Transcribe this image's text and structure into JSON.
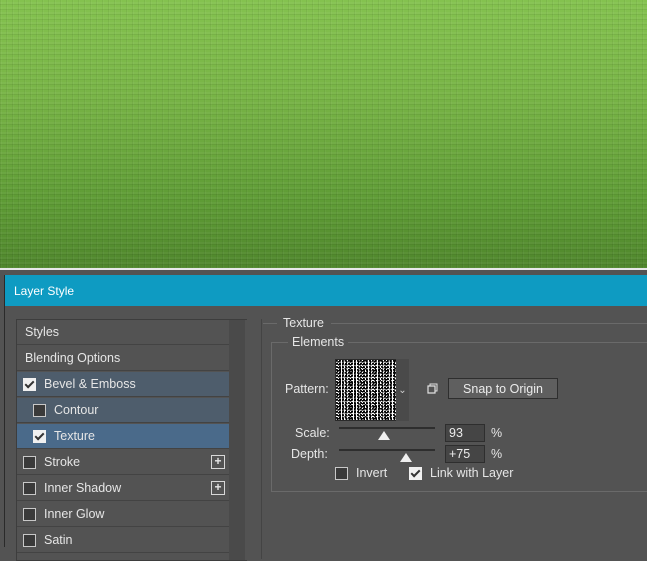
{
  "dialog": {
    "title": "Layer Style"
  },
  "styles_panel": {
    "items": [
      {
        "label": "Styles"
      },
      {
        "label": "Blending Options"
      },
      {
        "label": "Bevel & Emboss",
        "checked": true
      },
      {
        "label": "Contour",
        "checked": false
      },
      {
        "label": "Texture",
        "checked": true,
        "selected": true
      },
      {
        "label": "Stroke",
        "checked": false,
        "add": "+"
      },
      {
        "label": "Inner Shadow",
        "checked": false,
        "add": "+"
      },
      {
        "label": "Inner Glow",
        "checked": false
      },
      {
        "label": "Satin",
        "checked": false
      }
    ]
  },
  "texture": {
    "section_title": "Texture",
    "group_title": "Elements",
    "pattern_label": "Pattern:",
    "snap_button": "Snap to Origin",
    "scale_label": "Scale:",
    "scale_value": "93",
    "scale_unit": "%",
    "depth_label": "Depth:",
    "depth_value": "+75",
    "depth_unit": "%",
    "invert_label": "Invert",
    "invert_checked": false,
    "link_label": "Link with Layer",
    "link_checked": true
  }
}
